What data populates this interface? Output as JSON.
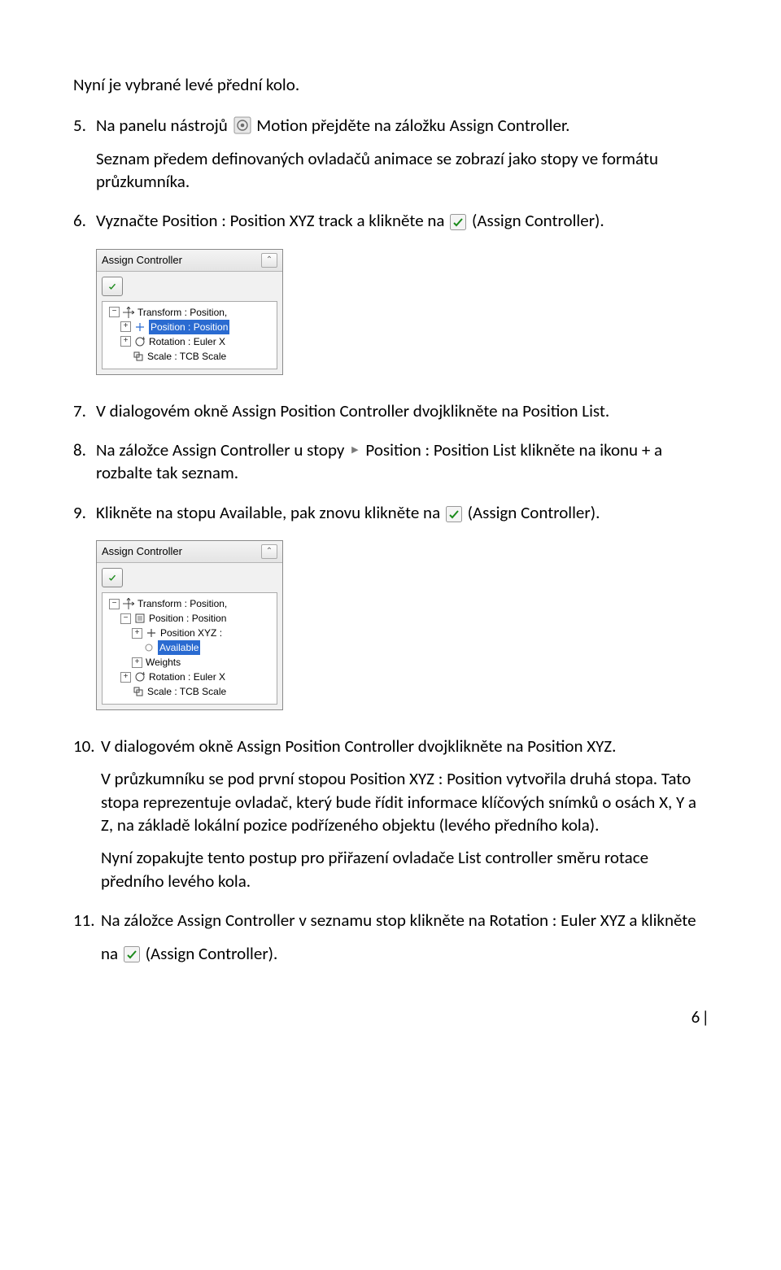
{
  "intro": "Nyní je vybrané levé přední kolo.",
  "step5": {
    "num": "5.",
    "a": "Na panelu nástrojů",
    "b": "Motion přejděte na záložku Assign Controller.",
    "c": "Seznam předem definovaných ovladačů animace se zobrazí jako stopy ve formátu průzkumníka."
  },
  "step6": {
    "num": "6.",
    "a": "Vyznačte Position : Position XYZ track a klikněte na",
    "b": "(Assign Controller)."
  },
  "fig1": {
    "title": "Assign Controller",
    "items": [
      "Transform : Position,",
      "Position : Position",
      "Rotation : Euler X",
      "Scale : TCB Scale"
    ]
  },
  "step7": {
    "num": "7.",
    "text": "V dialogovém okně Assign Position Controller dvojklikněte na Position List."
  },
  "step8": {
    "num": "8.",
    "a": "Na záložce Assign Controller u stopy",
    "b": "Position : Position List klikněte na ikonu +  a rozbalte tak seznam."
  },
  "step9": {
    "num": "9.",
    "a": "Klikněte na stopu Available, pak znovu klikněte na",
    "b": "(Assign Controller)."
  },
  "fig2": {
    "title": "Assign Controller",
    "items": [
      "Transform : Position,",
      "Position : Position",
      "Position XYZ :",
      "Available",
      "Weights",
      "Rotation : Euler X",
      "Scale : TCB Scale"
    ]
  },
  "step10": {
    "num": "10.",
    "a": "V dialogovém okně Assign Position Controller dvojklikněte na Position XYZ.",
    "b": "V průzkumníku se pod první stopou Position XYZ : Position vytvořila druhá stopa. Tato stopa reprezentuje ovladač, který bude řídit informace klíčových snímků o osách X, Y a Z, na základě lokální pozice podřízeného objektu (levého předního kola).",
    "c": "Nyní zopakujte tento postup pro přiřazení ovladače List controller směru rotace předního levého kola."
  },
  "step11": {
    "num": "11.",
    "a": "Na záložce Assign Controller v seznamu stop klikněte na Rotation : Euler XYZ a klikněte",
    "b": "na",
    "c": "(Assign Controller)."
  },
  "page_number": "6"
}
